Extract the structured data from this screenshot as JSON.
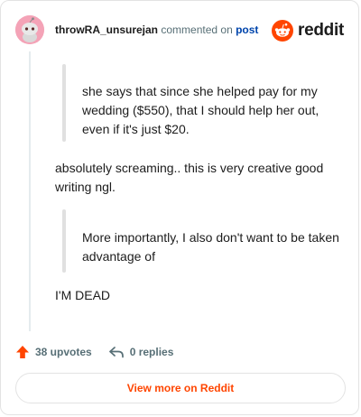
{
  "header": {
    "username": "throwRA_unsurejan",
    "action_text": "commented on",
    "post_link": "post",
    "brand": "reddit"
  },
  "comment": {
    "quote1": "she says that since she helped pay for my wedding ($550), that I should help her out, even if it's just $20.",
    "paragraph1": "absolutely screaming.. this is very creative good writing ngl.",
    "quote2": "More importantly, I also don't want to be taken advantage of",
    "paragraph2": "I'M DEAD"
  },
  "footer": {
    "upvotes": "38 upvotes",
    "replies": "0 replies"
  },
  "cta": {
    "view_more": "View more on Reddit"
  },
  "colors": {
    "accent": "#ff4500",
    "link": "#0045ac",
    "muted": "#576f76"
  }
}
